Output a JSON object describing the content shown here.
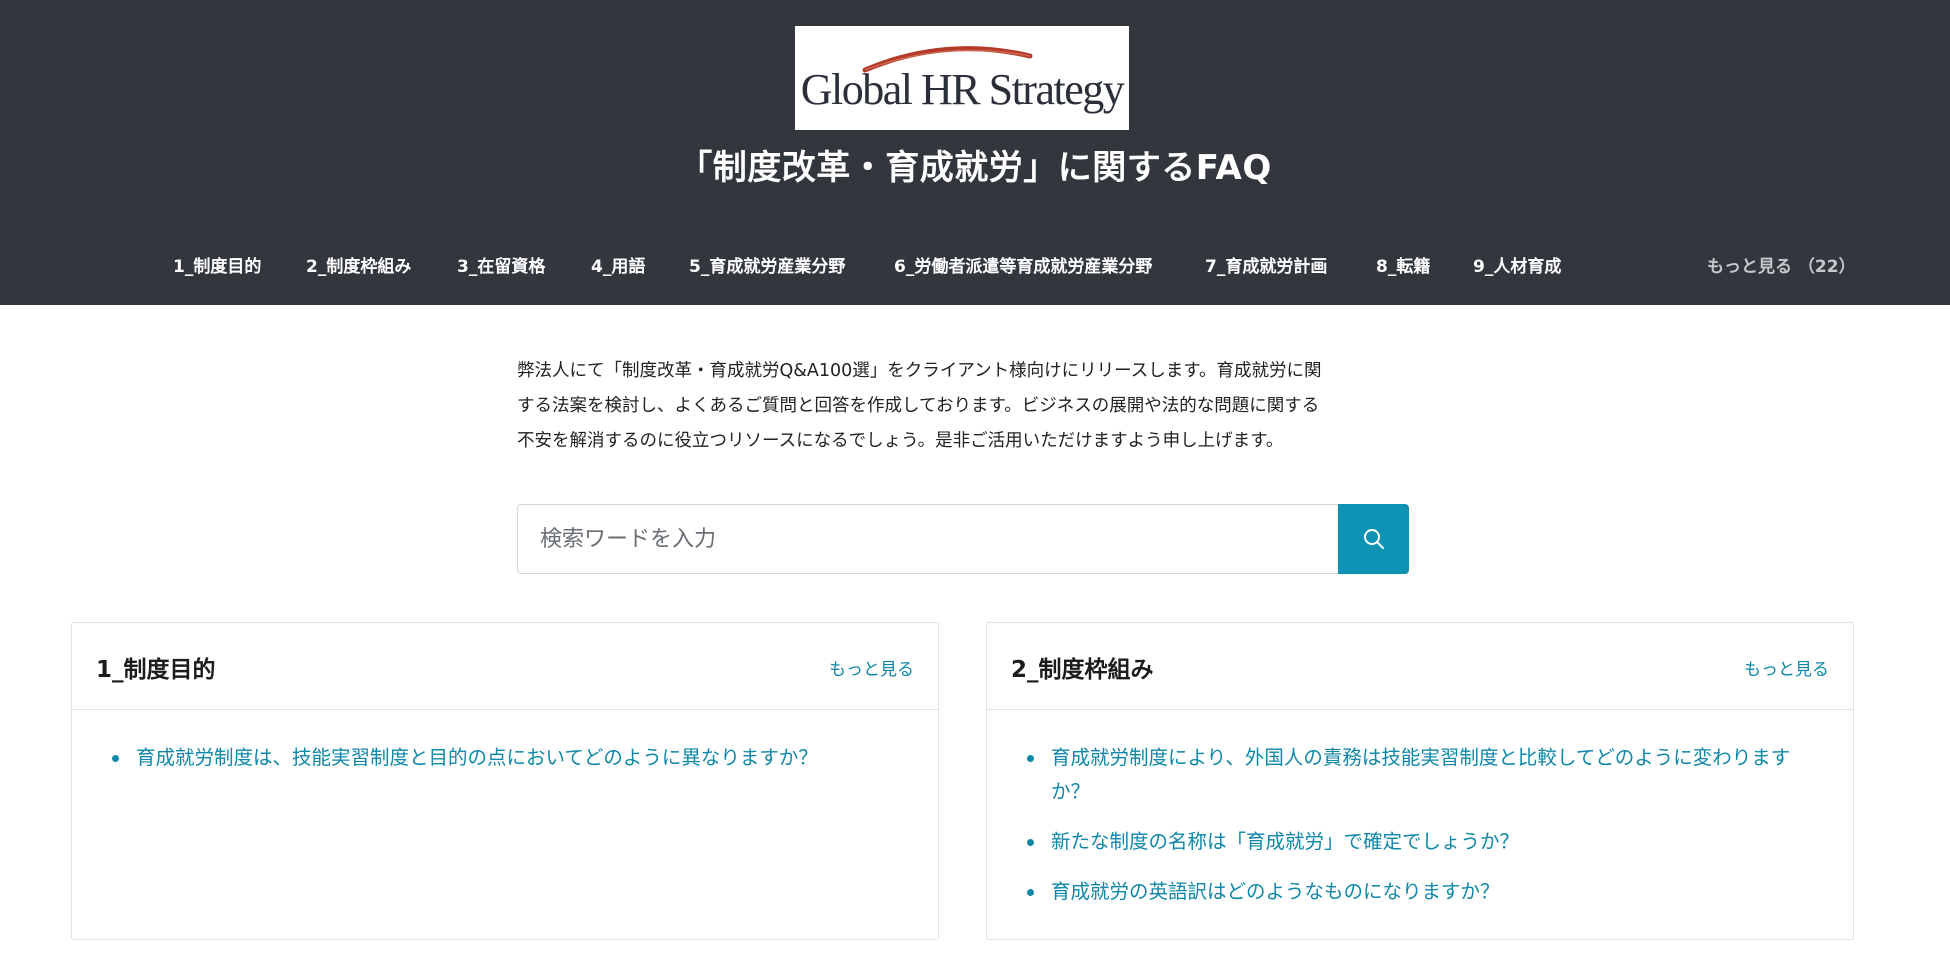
{
  "header": {
    "logo_text": "Global HR Strategy",
    "title": "「制度改革・育成就労」に関するFAQ",
    "nav": [
      {
        "label": "1_制度目的"
      },
      {
        "label": "2_制度枠組み"
      },
      {
        "label": "3_在留資格"
      },
      {
        "label": "4_用語"
      },
      {
        "label": "5_育成就労産業分野"
      },
      {
        "label": "6_労働者派遣等育成就労産業分野"
      },
      {
        "label": "7_育成就労計画"
      },
      {
        "label": "8_転籍"
      },
      {
        "label": "9_人材育成"
      }
    ],
    "more_label": "もっと見る （22）"
  },
  "intro": {
    "line1": "弊法人にて「制度改革・育成就労Q&A100選」をクライアント様向けにリリースします。育成就労に関",
    "line2": "する法案を検討し、よくあるご質問と回答を作成しております。ビジネスの展開や法的な問題に関する",
    "line3": "不安を解消するのに役立つリソースになるでしょう。是非ご活用いただけますよう申し上げます。"
  },
  "search": {
    "placeholder": "検索ワードを入力",
    "value": "",
    "button_icon": "search-icon"
  },
  "cards": [
    {
      "title": "1_制度目的",
      "more_label": "もっと見る",
      "items": [
        {
          "text": "育成就労制度は、技能実習制度と目的の点においてどのように異なりますか？"
        }
      ]
    },
    {
      "title": "2_制度枠組み",
      "more_label": "もっと見る",
      "items": [
        {
          "text": "育成就労制度により、外国人の責務は技能実習制度と比較してどのように変わりますか？"
        },
        {
          "text": "新たな制度の名称は「育成就労」で確定でしょうか？"
        },
        {
          "text": "育成就労の英語訳はどのようなものになりますか？"
        }
      ]
    }
  ],
  "colors": {
    "header_bg": "#32363d",
    "accent": "#0f93b5",
    "link": "#0f87a8"
  }
}
